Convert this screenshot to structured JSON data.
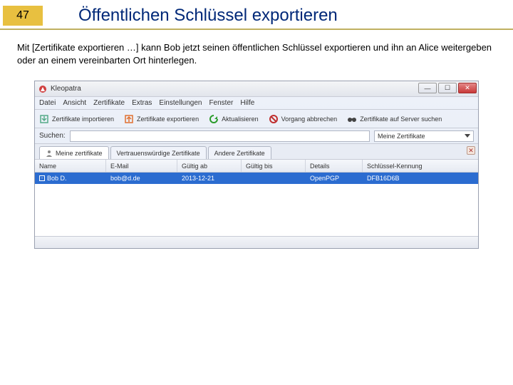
{
  "slide": {
    "number": "47",
    "title": "Öffentlichen Schlüssel exportieren",
    "body": "Mit [Zertifikate exportieren …] kann Bob jetzt seinen öffentlichen Schlüssel exportieren und ihn an Alice weitergeben oder an einem vereinbarten Ort hinterlegen."
  },
  "window": {
    "app_title": "Kleopatra",
    "menubar": [
      "Datei",
      "Ansicht",
      "Zertifikate",
      "Extras",
      "Einstellungen",
      "Fenster",
      "Hilfe"
    ],
    "toolbar": {
      "import": "Zertifikate importieren",
      "export": "Zertifikate exportieren",
      "refresh": "Aktualisieren",
      "cancel": "Vorgang abbrechen",
      "server_search": "Zertifikate auf Server suchen"
    },
    "search": {
      "label": "Suchen:",
      "value": "",
      "select": "Meine Zertifikate"
    },
    "tabs": [
      "Meine zertifikate",
      "Vertrauenswürdige Zertifikate",
      "Andere Zertifikate"
    ],
    "table": {
      "headers": {
        "name": "Name",
        "email": "E-Mail",
        "valid_from": "Gültig ab",
        "valid_until": "Gültig bis",
        "details": "Details",
        "key_id": "Schlüssel-Kennung"
      },
      "row": {
        "name": "Bob D.",
        "email": "bob@d.de",
        "valid_from": "2013-12-21",
        "valid_until": "",
        "details": "OpenPGP",
        "key_id": "DFB16D6B"
      }
    }
  }
}
